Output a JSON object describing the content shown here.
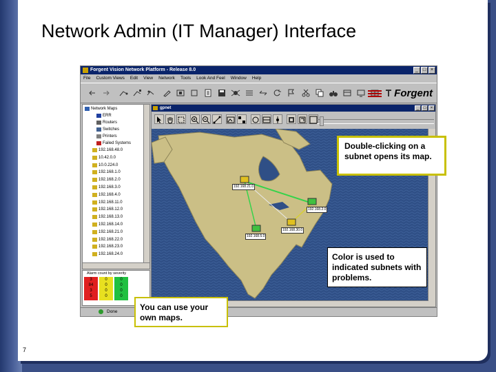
{
  "slide": {
    "title": "Network Admin (IT Manager) Interface",
    "page_number": "7"
  },
  "app": {
    "window_title": "Forgent Vision Network Platform - Release 8.0",
    "menu": [
      "File",
      "Custom Views",
      "Edit",
      "View",
      "Network",
      "Tools",
      "Look And Feel",
      "Window",
      "Help"
    ],
    "brand": "Forgent",
    "status_text": "Done"
  },
  "tree": {
    "root": "Network Maps",
    "children": [
      "ERR",
      "Routers",
      "Switches",
      "Printers",
      "Failed Systems"
    ],
    "subnets": [
      "192.168.48.0",
      "10.42.0.0",
      "10.0.224.0",
      "192.168.1.0",
      "192.168.2.0",
      "192.168.3.0",
      "192.168.4.0",
      "192.168.11.0",
      "192.168.12.0",
      "192.168.13.0",
      "192.168.14.0",
      "192.168.21.0",
      "192.168.22.0",
      "192.168.23.0",
      "192.168.24.0"
    ]
  },
  "alarm": {
    "title": "Alarm count by severity",
    "columns": [
      {
        "color": "#e02020",
        "values": [
          "3",
          "84",
          "3",
          "5"
        ]
      },
      {
        "color": "#e8e020",
        "values": [
          "0",
          "0",
          "0",
          "0"
        ]
      },
      {
        "color": "#20c040",
        "values": [
          "0",
          "0",
          "0",
          "0"
        ]
      }
    ]
  },
  "map": {
    "window_title": "gpnet",
    "nodes": [
      {
        "label": "192.168.21.0"
      },
      {
        "label": "192.168.2.0"
      },
      {
        "label": "192.168.5.0"
      },
      {
        "label": "192.168.30.0"
      }
    ]
  },
  "callouts": {
    "subnet_tip": "Double-clicking on a subnet opens its map.",
    "color_tip": "Color is used to indicated subnets with problems.",
    "maps_tip": "You can use your own maps."
  }
}
